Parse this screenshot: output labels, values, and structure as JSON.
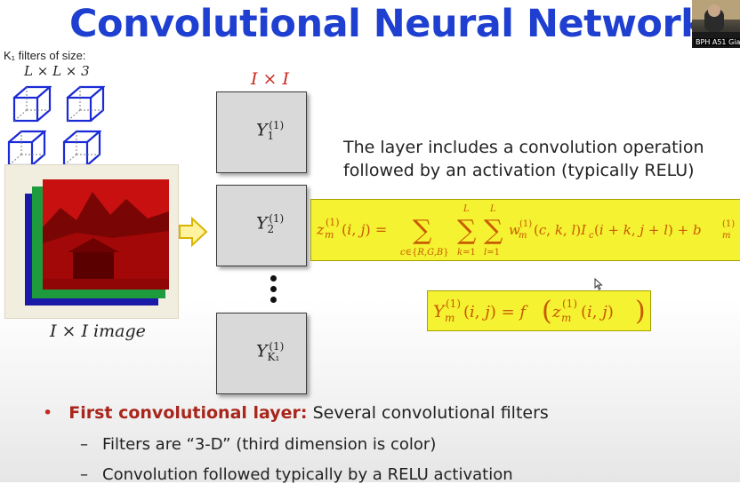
{
  "slide": {
    "title": "Convolutional Neural Networks",
    "webcam_label": "BPH A51 Gia",
    "filters_label": "K₁ filters of size:",
    "filters_size": "L × L × 3",
    "image_label": "I × I image",
    "output_size_label": "I × I",
    "feature_maps": [
      {
        "base": "Y",
        "sub": "1",
        "sup": "(1)"
      },
      {
        "base": "Y",
        "sub": "2",
        "sup": "(1)"
      },
      {
        "base": "Y",
        "sub": "K₁",
        "sup": "(1)"
      }
    ],
    "description_lines": [
      "The layer includes a convolution operation",
      "followed by an activation (typically RELU)"
    ],
    "equation_1": "z_m^(1)(i,j) = Σ_{c∈{R,G,B}} Σ_{k=1}^{L} Σ_{l=1}^{L} w_m^(1)(c,k,l) I_c(i+k, j+l) + b_m^(1)",
    "equation_2": "Y_m^(1)(i,j) = f(z_m^(1)(i,j))",
    "bullet_main_bold": "First convolutional layer:",
    "bullet_main_rest": "Several convolutional filters",
    "sub_bullets": [
      "Filters are “3-D” (third dimension is color)",
      "Convolution followed typically by a RELU activation"
    ],
    "colors": {
      "title": "#1f3fd1",
      "accent_red": "#c8281e",
      "equation_bg": "#f5f232",
      "equation_text": "#c85a00"
    },
    "icons": [
      "filter-cube-icon",
      "arrow-right-icon",
      "mouse-cursor-icon"
    ]
  }
}
